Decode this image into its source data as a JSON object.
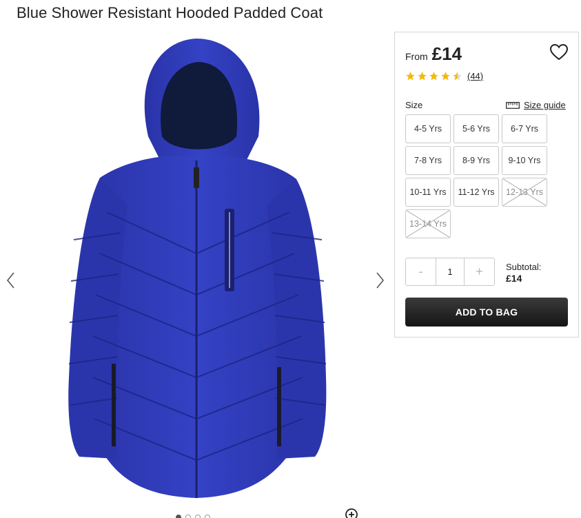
{
  "product": {
    "title": "Blue Shower Resistant Hooded Padded Coat",
    "image_description_icon": "blue-puffer-coat-image"
  },
  "gallery": {
    "prev_icon": "chevron-left-icon",
    "next_icon": "chevron-right-icon",
    "zoom_icon": "zoom-in-icon",
    "image_count": 4,
    "active_image": 1
  },
  "panel": {
    "price_prefix": "From",
    "price": "£14",
    "wishlist_icon": "heart-icon",
    "rating": 4.5,
    "rating_max": 5,
    "review_count": "(44)",
    "size_label": "Size",
    "size_guide_label": "Size guide",
    "size_guide_icon": "ruler-icon",
    "sizes": [
      {
        "label": "4-5 Yrs",
        "available": true
      },
      {
        "label": "5-6 Yrs",
        "available": true
      },
      {
        "label": "6-7 Yrs",
        "available": true
      },
      {
        "label": "7-8 Yrs",
        "available": true
      },
      {
        "label": "8-9 Yrs",
        "available": true
      },
      {
        "label": "9-10 Yrs",
        "available": true
      },
      {
        "label": "10-11 Yrs",
        "available": true
      },
      {
        "label": "11-12 Yrs",
        "available": true
      },
      {
        "label": "12-13 Yrs",
        "available": false
      },
      {
        "label": "13-14 Yrs",
        "available": false
      }
    ],
    "quantity": {
      "minus_label": "-",
      "value": "1",
      "plus_label": "+"
    },
    "subtotal_label": "Subtotal:",
    "subtotal_value": "£14",
    "add_to_bag_label": "ADD TO BAG"
  },
  "colors": {
    "star": "#f5b800",
    "button_dark": "#1e1e1e",
    "coat_blue": "#2f3db8"
  }
}
